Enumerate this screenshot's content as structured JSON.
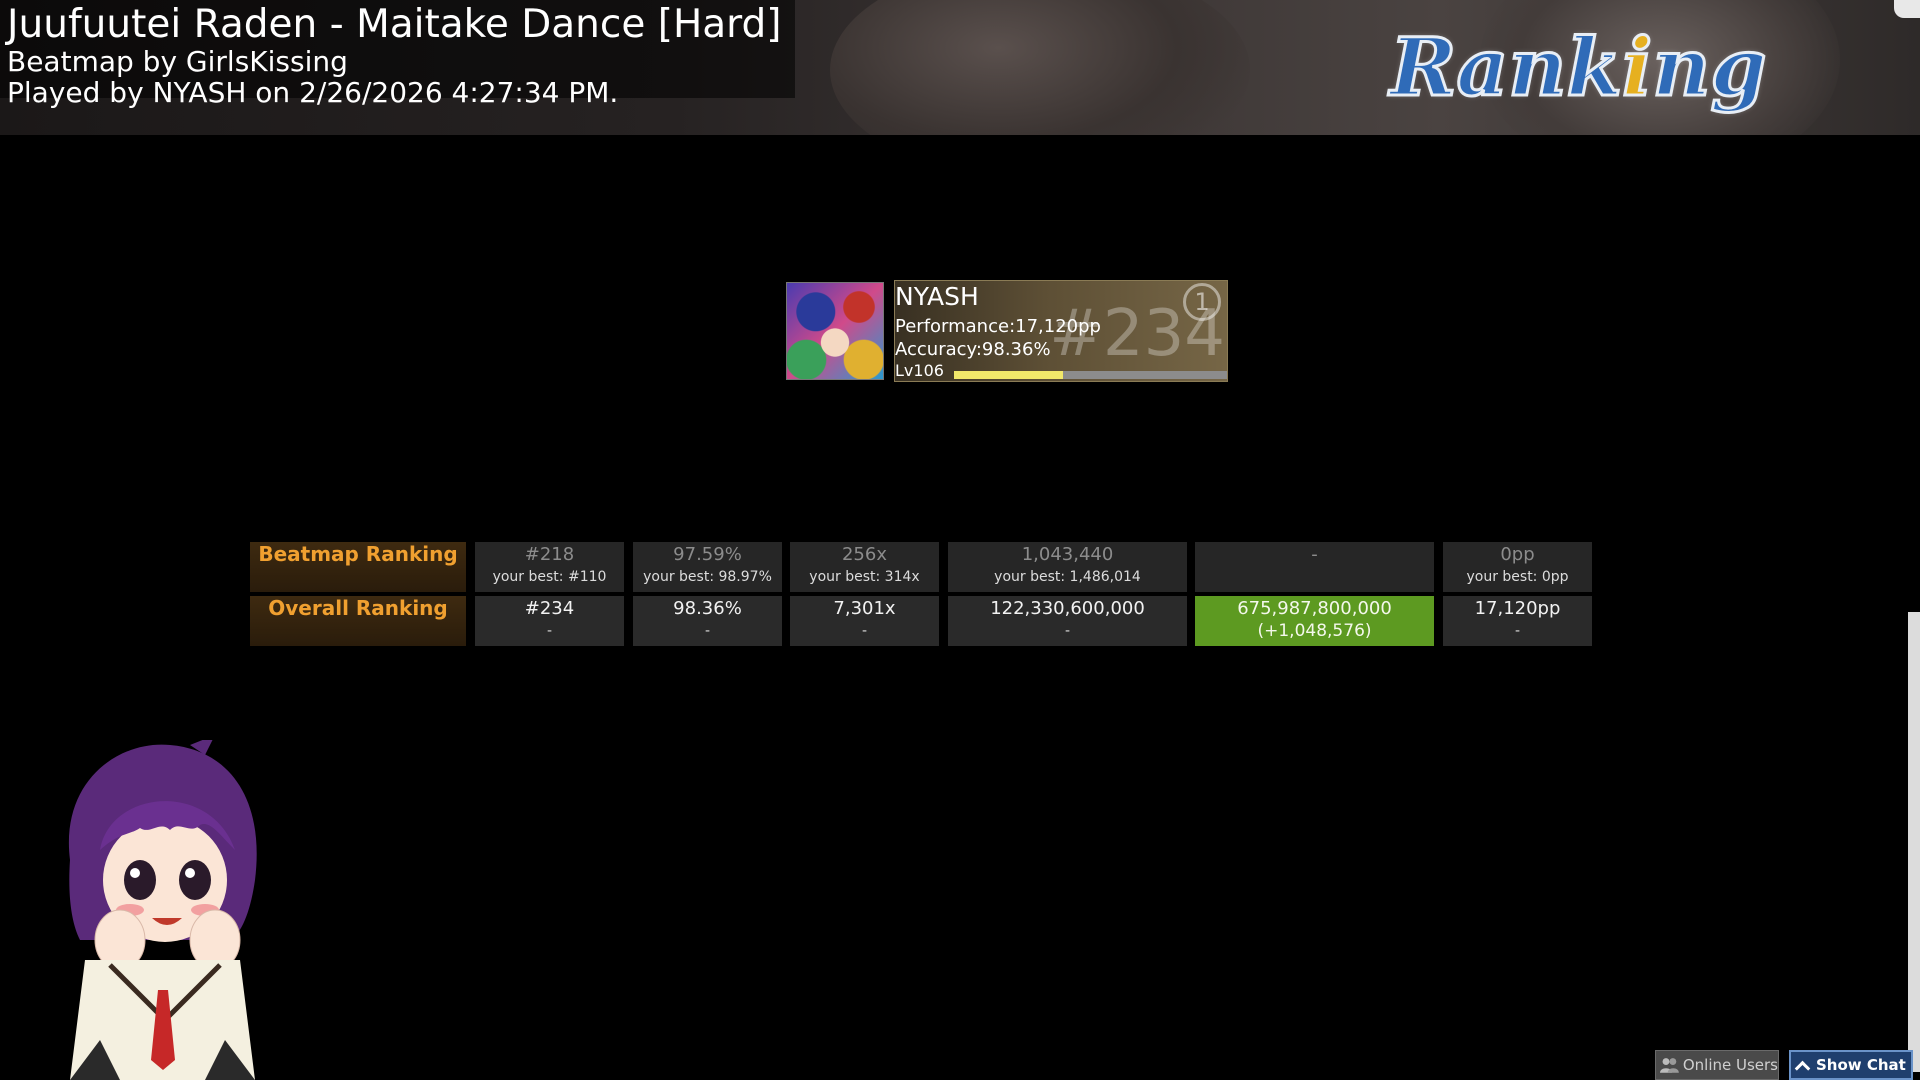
{
  "header": {
    "song_title": "Juufuutei Raden - Maitake Dance [Hard]",
    "mapper_line": "Beatmap by GirlsKissing",
    "played_line": "Played by NYASH on 2/26/2026 4:27:34 PM.",
    "ranking_logo_letters": [
      "R",
      "a",
      "n",
      "k",
      "i",
      "n",
      "g"
    ],
    "ranking_logo_colors": {
      "main": "#2f6bb8",
      "accent": "#e6b020",
      "outline": "#e8eef5"
    }
  },
  "player": {
    "name": "NYASH",
    "performance": "Performance:17,120pp",
    "accuracy": "Accuracy:98.36%",
    "level": "Lv106",
    "level_progress": 0.4,
    "rank": "#234",
    "badge": "1"
  },
  "ranking_table": {
    "beatmap_label": "Beatmap Ranking",
    "overall_label": "Overall Ranking",
    "beatmap_cells": [
      {
        "main": "#218",
        "sub": "your best: #110"
      },
      {
        "main": "97.59%",
        "sub": "your best: 98.97%"
      },
      {
        "main": "256x",
        "sub": "your best: 314x"
      },
      {
        "main": "1,043,440",
        "sub": "your best: 1,486,014"
      },
      {
        "main": "-",
        "sub": ""
      },
      {
        "main": "0pp",
        "sub": "your best: 0pp"
      }
    ],
    "overall_cells": [
      {
        "main": "#234",
        "sub": "-"
      },
      {
        "main": "98.36%",
        "sub": "-"
      },
      {
        "main": "7,301x",
        "sub": "-"
      },
      {
        "main": "122,330,600,000",
        "sub": "-"
      },
      {
        "main": "675,987,800,000",
        "sub": "(+1,048,576)",
        "highlight": true
      },
      {
        "main": "17,120pp",
        "sub": "-"
      }
    ],
    "colors": {
      "label_text": "#f0a030",
      "highlight": "#5d9a21"
    }
  },
  "footer": {
    "online_users": "Online Users",
    "show_chat": "Show Chat"
  }
}
